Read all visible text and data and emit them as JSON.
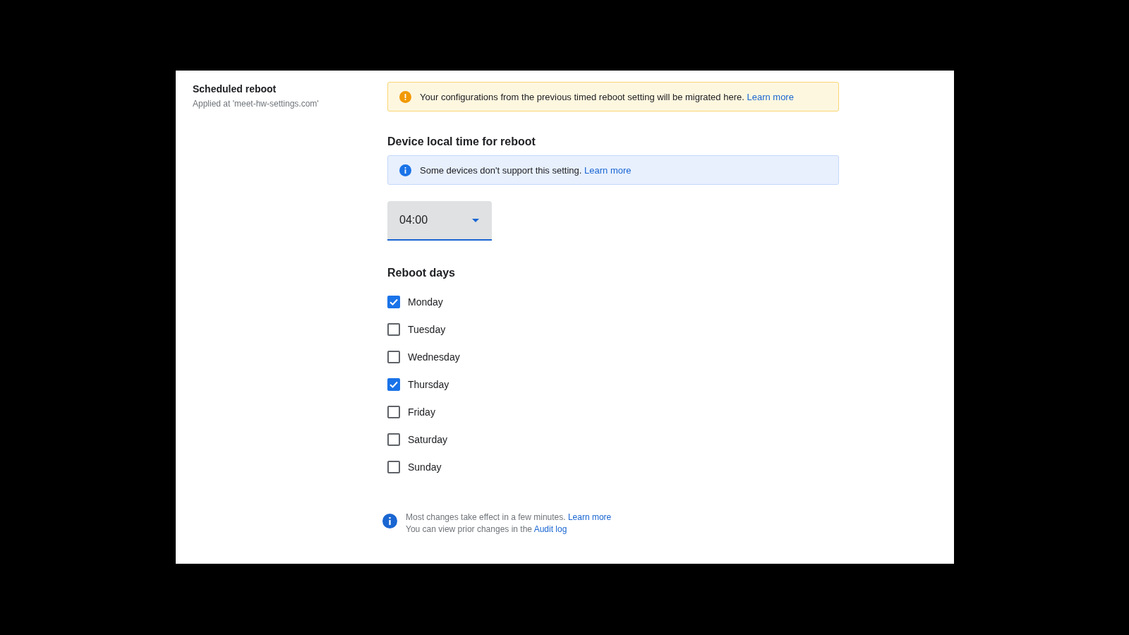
{
  "section": {
    "title": "Scheduled reboot",
    "subtitle": "Applied at 'meet-hw-settings.com'"
  },
  "banners": [
    {
      "kind": "warning",
      "text": "Your configurations from the previous timed reboot setting will be migrated here.",
      "link": "Learn more"
    }
  ],
  "time": {
    "heading": "Device local time for reboot",
    "banner": {
      "kind": "info",
      "text": "Some devices don't support this setting.",
      "link": "Learn more"
    },
    "select": {
      "value": "04:00"
    }
  },
  "days": {
    "heading": "Reboot days",
    "items": [
      {
        "label": "Monday",
        "checked": true
      },
      {
        "label": "Tuesday",
        "checked": false
      },
      {
        "label": "Wednesday",
        "checked": false
      },
      {
        "label": "Thursday",
        "checked": true
      },
      {
        "label": "Friday",
        "checked": false
      },
      {
        "label": "Saturday",
        "checked": false
      },
      {
        "label": "Sunday",
        "checked": false
      }
    ]
  },
  "footer": {
    "lines": [
      {
        "text": "Most changes take effect in a few minutes.",
        "link": "Learn more"
      },
      {
        "text": "You can view prior changes in the",
        "link": "Audit log"
      }
    ]
  }
}
